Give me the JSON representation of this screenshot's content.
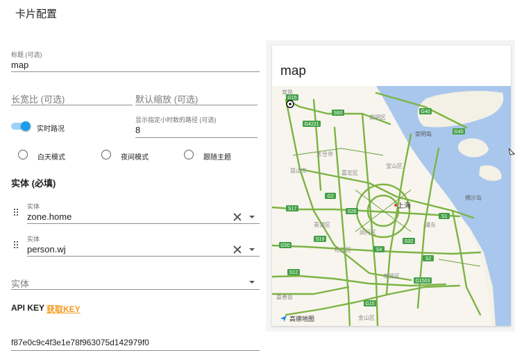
{
  "dialog": {
    "title": "卡片配置"
  },
  "form": {
    "title_field": {
      "label": "标题 (可选)",
      "value": "map"
    },
    "aspect_ratio": {
      "placeholder": "长宽比 (可选)"
    },
    "default_zoom": {
      "placeholder": "默认缩放 (可选)"
    },
    "traffic_toggle": {
      "label": "实时路况",
      "checked": true
    },
    "hours_to_show": {
      "label": "显示指定小时数的路径 (可选)",
      "value": "8"
    },
    "theme_modes": [
      {
        "label": "白天模式"
      },
      {
        "label": "夜间模式"
      },
      {
        "label": "跟随主题"
      }
    ],
    "entities_title": "实体 (必填)",
    "entities": [
      {
        "label": "实体",
        "value": "zone.home"
      },
      {
        "label": "实体",
        "value": "person.wj"
      }
    ],
    "new_entity": {
      "placeholder": "实体"
    },
    "api_key": {
      "label": "API KEY",
      "link": "获取KEY",
      "value": "f87e0c9c4f3e1e78f963075d142979f0"
    }
  },
  "preview": {
    "title": "map",
    "map_logo": "高德地图",
    "places": {
      "p1": "常熟",
      "p2": "崇明区",
      "p3": "崇明岛",
      "p4": "太仓市",
      "p5": "昆山市",
      "p6": "嘉定区",
      "p7": "宝山区",
      "p8": "上海",
      "p9": "青浦区",
      "p10": "闵行区",
      "p11": "松江区",
      "p12": "奉贤区",
      "p13": "嘉善县",
      "p14": "金山区",
      "p15": "横沙岛",
      "p16": "浦东"
    },
    "roads": {
      "r1": "G15",
      "r2": "S60",
      "r3": "G40",
      "r4": "G40",
      "r5": "G4221",
      "r6": "G2",
      "r7": "S17",
      "r8": "S26",
      "r9": "S1",
      "r10": "G50",
      "r11": "S4",
      "r12": "S32",
      "r13": "S2",
      "r14": "S12",
      "r15": "G1503",
      "r16": "G15",
      "r17": "S19"
    }
  }
}
